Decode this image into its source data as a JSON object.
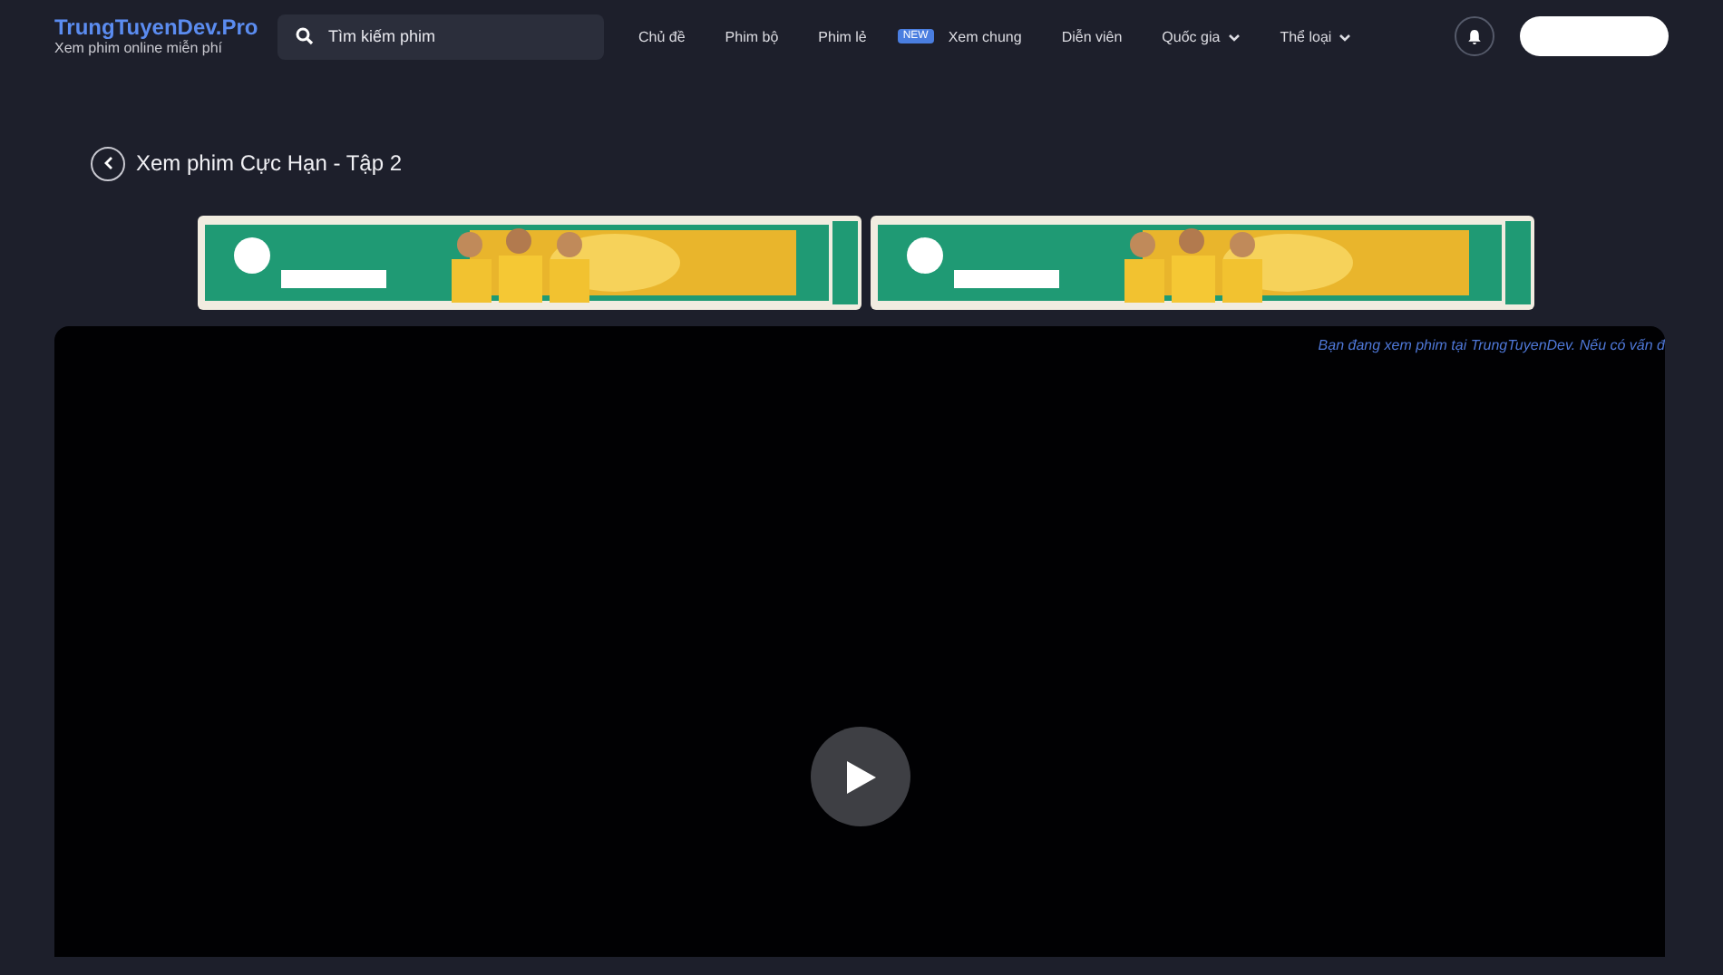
{
  "header": {
    "logo": {
      "title": "TrungTuyenDev.Pro",
      "subtitle": "Xem phim online miễn phí"
    },
    "search": {
      "placeholder": "Tìm kiếm phim"
    },
    "nav": [
      {
        "label": "Chủ đề",
        "kind": "link"
      },
      {
        "label": "Phim bộ",
        "kind": "link"
      },
      {
        "label": "Phim lẻ",
        "kind": "link"
      },
      {
        "label": "Xem chung",
        "kind": "link",
        "badge": "NEW"
      },
      {
        "label": "Diễn viên",
        "kind": "link"
      },
      {
        "label": "Quốc gia",
        "kind": "dropdown"
      },
      {
        "label": "Thể loại",
        "kind": "dropdown"
      }
    ]
  },
  "page": {
    "title": "Xem phim Cực Hạn - Tập 2"
  },
  "player": {
    "notice": "Bạn đang xem phim tại TrungTuyenDev. Nếu có vấn đ"
  }
}
